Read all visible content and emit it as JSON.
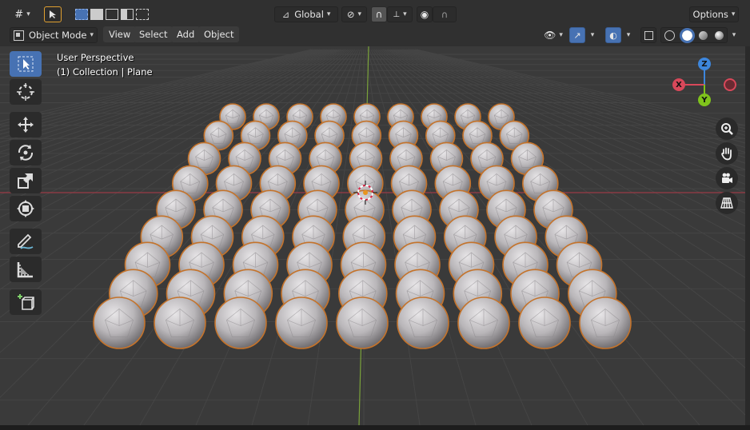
{
  "toolbar": {
    "editor_type_icon": "grid-editor-icon",
    "select_tool_icon": "cursor-icon",
    "transform_orientation": "Global",
    "options_label": "Options"
  },
  "header": {
    "mode_label": "Object Mode",
    "menu": [
      "View",
      "Select",
      "Add",
      "Object"
    ]
  },
  "viewport": {
    "perspective_label": "User Perspective",
    "collection_label": "(1) Collection | Plane",
    "gizmo": {
      "x_label": "X",
      "y_label": "Y",
      "z_label": "Z"
    },
    "colors": {
      "x_axis": "#d8485a",
      "y_axis": "#7fc31c",
      "z_axis": "#3d86dc",
      "accent": "#4772b3",
      "selected_outline": "#c4732b"
    }
  },
  "tools": [
    "select-box",
    "cursor",
    "move",
    "rotate",
    "scale",
    "transform",
    "annotate",
    "measure",
    "add-cube"
  ],
  "nav_buttons": [
    "zoom",
    "pan",
    "camera",
    "grid-view"
  ]
}
